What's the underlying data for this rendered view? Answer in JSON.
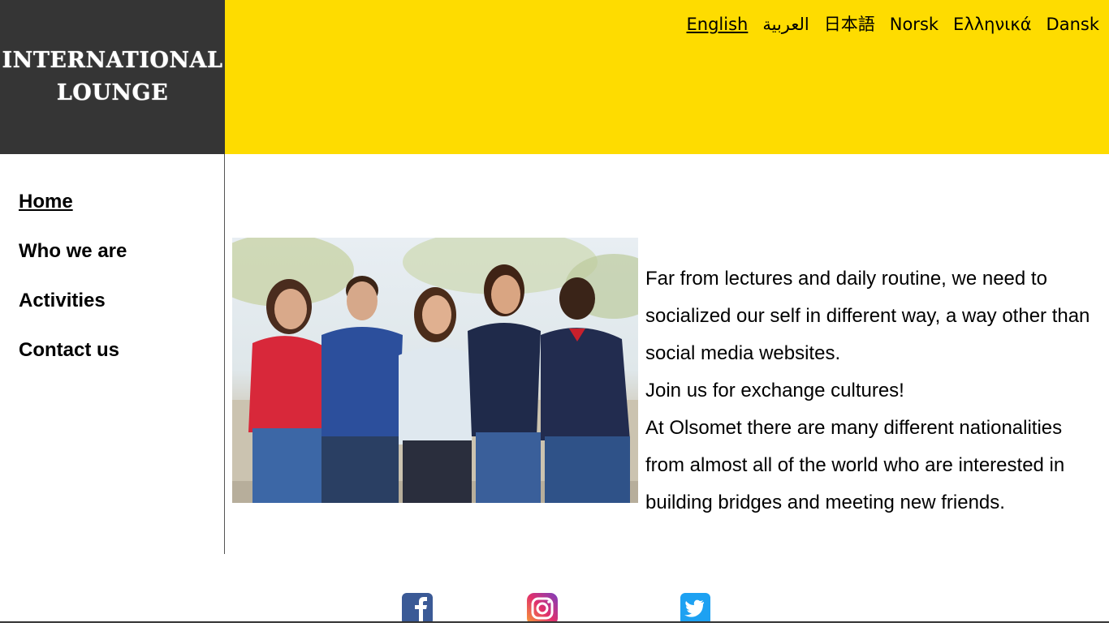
{
  "logo": {
    "line1": "INTERNATIONAL",
    "line2": "LOUNGE"
  },
  "languages": [
    {
      "label": "English",
      "active": true
    },
    {
      "label": "العربية",
      "active": false
    },
    {
      "label": "日本語",
      "active": false
    },
    {
      "label": "Norsk",
      "active": false
    },
    {
      "label": "Ελληνικά",
      "active": false
    },
    {
      "label": "Dansk",
      "active": false
    }
  ],
  "nav": {
    "items": [
      {
        "label": "Home",
        "active": true
      },
      {
        "label": "Who we are",
        "active": false
      },
      {
        "label": "Activities",
        "active": false
      },
      {
        "label": "Contact us",
        "active": false
      }
    ]
  },
  "intro": {
    "paragraph1": "Far from lectures and daily routine, we need to socialized our self in different way, a way other than social media websites.",
    "paragraph2": "Join us for exchange cultures!",
    "paragraph3": "At Olsomet there are many different nationalities from almost all of the world who are interested in building bridges and meeting new friends."
  },
  "colors": {
    "header": "#fedc00",
    "logo_bg": "#353535"
  },
  "social": [
    "facebook-icon",
    "instagram-icon",
    "twitter-icon"
  ]
}
